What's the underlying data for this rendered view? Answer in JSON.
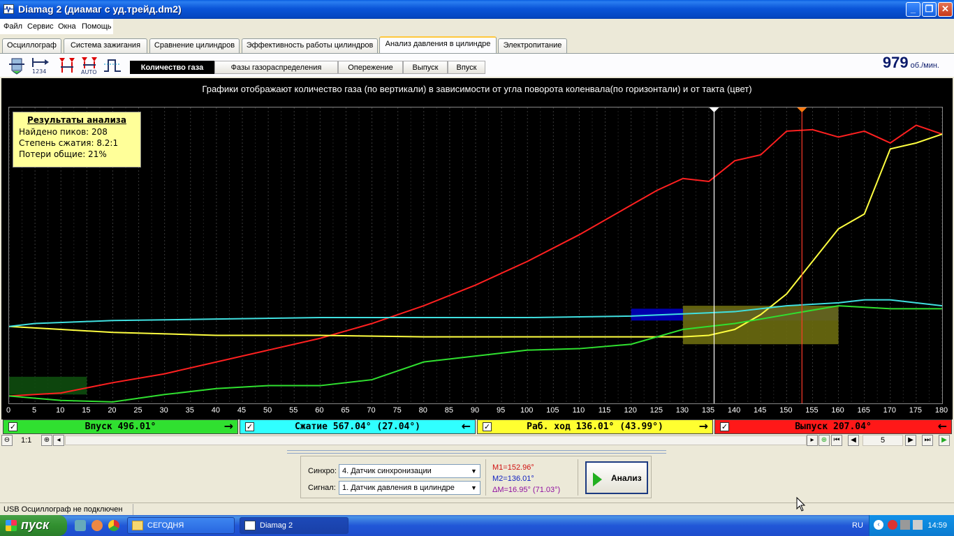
{
  "window": {
    "title": "Diamag 2 (диамаг с уд.трейд.dm2)"
  },
  "menu": [
    "Файл",
    "Сервис",
    "Окна",
    "Помощь"
  ],
  "tabs": [
    "Осциллограф",
    "Система зажигания",
    "Сравнение цилиндров",
    "Эффективность работы цилиндров",
    "Анализ давления в цилиндре",
    "Электропитание"
  ],
  "active_tab": "Анализ давления в цилиндре",
  "toolbar": {
    "icons": [
      "cylinder-icon",
      "numbering-1234-icon",
      "markers-icon",
      "markers-auto-icon",
      "pulse-icon"
    ],
    "icon_caption_1234": "1234",
    "icon_caption_auto": "AUTO",
    "subtabs": [
      "Количество газа",
      "Фазы газораспределения",
      "Опережение",
      "Выпуск",
      "Впуск"
    ],
    "rpm_value": "979",
    "rpm_unit": "об./мин."
  },
  "chart": {
    "caption": "Графики отображают количество газа (по вертикали) в зависимости от угла поворота коленвала(по горизонтали) и от такта (цвет)",
    "results_title": "Результаты анализа",
    "results_lines": [
      "Найдено пиков: 208",
      "Степень сжатия: 8.2:1",
      "Потери общие: 21%"
    ]
  },
  "chart_data": {
    "type": "line",
    "xlabel": "",
    "ylabel": "",
    "x_ticks": [
      0,
      5,
      10,
      15,
      20,
      25,
      30,
      35,
      40,
      45,
      50,
      55,
      60,
      65,
      70,
      75,
      80,
      85,
      90,
      95,
      100,
      105,
      110,
      115,
      120,
      125,
      130,
      135,
      140,
      145,
      150,
      155,
      160,
      165,
      170,
      175,
      180
    ],
    "xlim": [
      0,
      180
    ],
    "ylim": [
      0,
      100
    ],
    "grid": true,
    "markers": {
      "M1": 152.96,
      "M2": 136.01
    },
    "series": [
      {
        "color": "#ff2020",
        "x": [
          0,
          10,
          20,
          30,
          40,
          50,
          60,
          70,
          80,
          90,
          100,
          110,
          120,
          125,
          130,
          135,
          140,
          145,
          150,
          155,
          160,
          165,
          170,
          175,
          180
        ],
        "values": [
          2.5,
          3.5,
          7,
          10,
          14,
          18,
          22,
          27,
          33,
          40,
          48,
          57,
          67,
          72,
          76,
          75,
          82,
          84,
          92,
          92.5,
          90,
          92,
          88,
          94,
          91
        ]
      },
      {
        "color": "#ffff40",
        "x": [
          0,
          10,
          20,
          40,
          60,
          80,
          100,
          120,
          130,
          135,
          140,
          145,
          150,
          155,
          160,
          165,
          170,
          175,
          180
        ],
        "values": [
          26,
          25,
          24,
          23,
          23,
          22.5,
          22.5,
          22.5,
          22.5,
          23,
          25,
          30,
          37,
          48,
          59,
          64,
          86,
          88,
          91
        ]
      },
      {
        "color": "#40e0e0",
        "x": [
          0,
          5,
          20,
          40,
          60,
          80,
          100,
          120,
          140,
          150,
          160,
          165,
          170,
          180
        ],
        "values": [
          26,
          27,
          28,
          28.5,
          29,
          29,
          29,
          29.5,
          31,
          33,
          34,
          35,
          35,
          33
        ]
      },
      {
        "color": "#30e030",
        "x": [
          0,
          10,
          20,
          30,
          40,
          50,
          60,
          70,
          80,
          90,
          100,
          110,
          120,
          130,
          140,
          150,
          160,
          170,
          180
        ],
        "values": [
          2.5,
          1,
          0.5,
          3,
          5,
          6,
          6,
          8,
          14,
          16,
          18,
          18.5,
          20,
          25,
          27,
          30,
          33,
          32,
          32
        ]
      }
    ],
    "bands": [
      {
        "color": "#0000c0",
        "x": [
          120,
          160
        ],
        "y": [
          28,
          32
        ]
      },
      {
        "color": "#6b6b10",
        "x": [
          130,
          160
        ],
        "y": [
          20,
          33
        ]
      },
      {
        "color": "#0e4d0e",
        "x": [
          0,
          15
        ],
        "y": [
          3,
          9
        ]
      }
    ]
  },
  "phases": [
    {
      "label": "Впуск 496.01°",
      "arrow": "→",
      "color": "#30e030"
    },
    {
      "label": "Сжатие 567.04° (27.04°)",
      "arrow": "←",
      "color": "#30ffff"
    },
    {
      "label": "Раб. ход 136.01° (43.99°)",
      "arrow": "→",
      "color": "#ffff30"
    },
    {
      "label": "Выпуск 207.04°",
      "arrow": "←",
      "color": "#ff1818"
    }
  ],
  "checkbox_mark": "✓",
  "scroll": {
    "zoom_label": "1:1",
    "page": "5"
  },
  "panel": {
    "sync_label": "Синхро:",
    "sync_value": "4.  Датчик синхронизации",
    "signal_label": "Сигнал:",
    "signal_value": "1.  Датчик давления в цилиндре",
    "m1": "M1=152.96°",
    "m2": "M2=136.01°",
    "dm": "ΔM=16.95° (71.03°)",
    "analyze": "Анализ"
  },
  "status": "USB Осциллограф не подключен",
  "taskbar": {
    "start": "пуск",
    "tasks": [
      "СЕГОДНЯ",
      "Diamag 2"
    ],
    "lang": "RU",
    "clock": "14:59"
  }
}
